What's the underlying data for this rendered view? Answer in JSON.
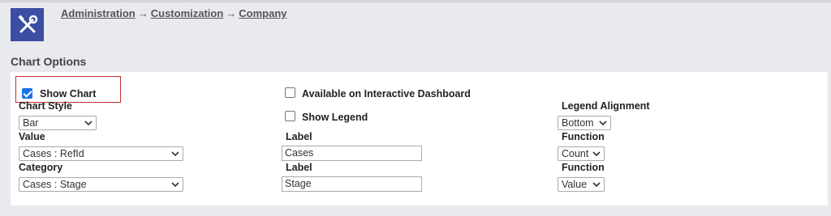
{
  "breadcrumb": {
    "items": [
      "Administration",
      "Customization",
      "Company"
    ],
    "separator": "→"
  },
  "section_title": "Chart Options",
  "options": {
    "show_chart": {
      "label": "Show Chart",
      "checked": true
    },
    "available_dashboard": {
      "label": "Available on Interactive Dashboard",
      "checked": false
    },
    "show_legend": {
      "label": "Show Legend",
      "checked": false
    }
  },
  "chart_style": {
    "label": "Chart Style",
    "value": "Bar"
  },
  "legend_alignment": {
    "label": "Legend Alignment",
    "value": "Bottom"
  },
  "value_row": {
    "label": "Value",
    "select": "Cases : RefId",
    "label_label": "Label",
    "label_value": "Cases",
    "function_label": "Function",
    "function_value": "Count"
  },
  "category_row": {
    "label": "Category",
    "select": "Cases : Stage",
    "label_label": "Label",
    "label_value": "Stage",
    "function_label": "Function",
    "function_value": "Value"
  },
  "colors": {
    "logo_bg": "#3c4ea3",
    "highlight": "#c0302b",
    "checkbox": "#1a73e8"
  }
}
